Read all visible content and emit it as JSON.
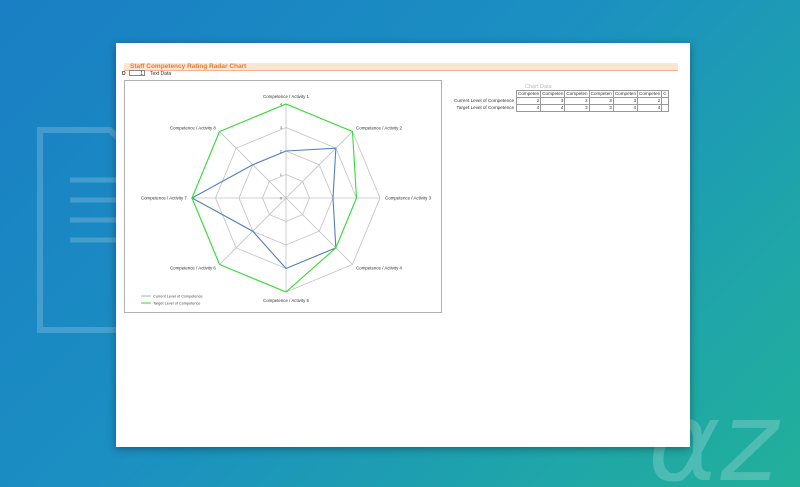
{
  "page": {
    "title": "Staff Competency Rating Radar Chart",
    "text_row": {
      "label": "D",
      "box_value": "1",
      "value": "Text Data"
    }
  },
  "chart_table": {
    "title": "Chart Data",
    "headers": [
      "Competen",
      "Competen",
      "Competen",
      "Competen",
      "Competen",
      "Competen",
      "C"
    ],
    "rows": [
      {
        "label": "Current Level of Competence",
        "values": [
          "2",
          "3",
          "2",
          "3",
          "3",
          "2",
          ""
        ]
      },
      {
        "label": "Target Level of Competence",
        "values": [
          "4",
          "4",
          "3",
          "3",
          "4",
          "4",
          ""
        ]
      }
    ]
  },
  "chart_data": {
    "type": "radar",
    "title": "",
    "categories": [
      "Competence / Activity 1",
      "Competence / Activity 2",
      "Competence / Activity 3",
      "Competence / Activity 4",
      "Competence / Activity 5",
      "Competence / Activity 6",
      "Competence / Activity 7",
      "Competence / Activity 8"
    ],
    "rlim": [
      0,
      4
    ],
    "ticks": [
      "0",
      "1",
      "2",
      "3",
      "4"
    ],
    "grid": true,
    "legend": "bottom-left",
    "series": [
      {
        "name": "Current Level of Competence",
        "color": "#4f81bd",
        "values": [
          2,
          3,
          2,
          3,
          3,
          2,
          4,
          2
        ]
      },
      {
        "name": "Target Level of Competence",
        "color": "#33dd33",
        "values": [
          4,
          4,
          3,
          3,
          4,
          4,
          4,
          4
        ]
      }
    ],
    "legend_colors": [
      "#b0b0b0",
      "#33dd33"
    ]
  },
  "colors": {
    "title": "#e57c3b",
    "grid": "#c0c0c0"
  }
}
